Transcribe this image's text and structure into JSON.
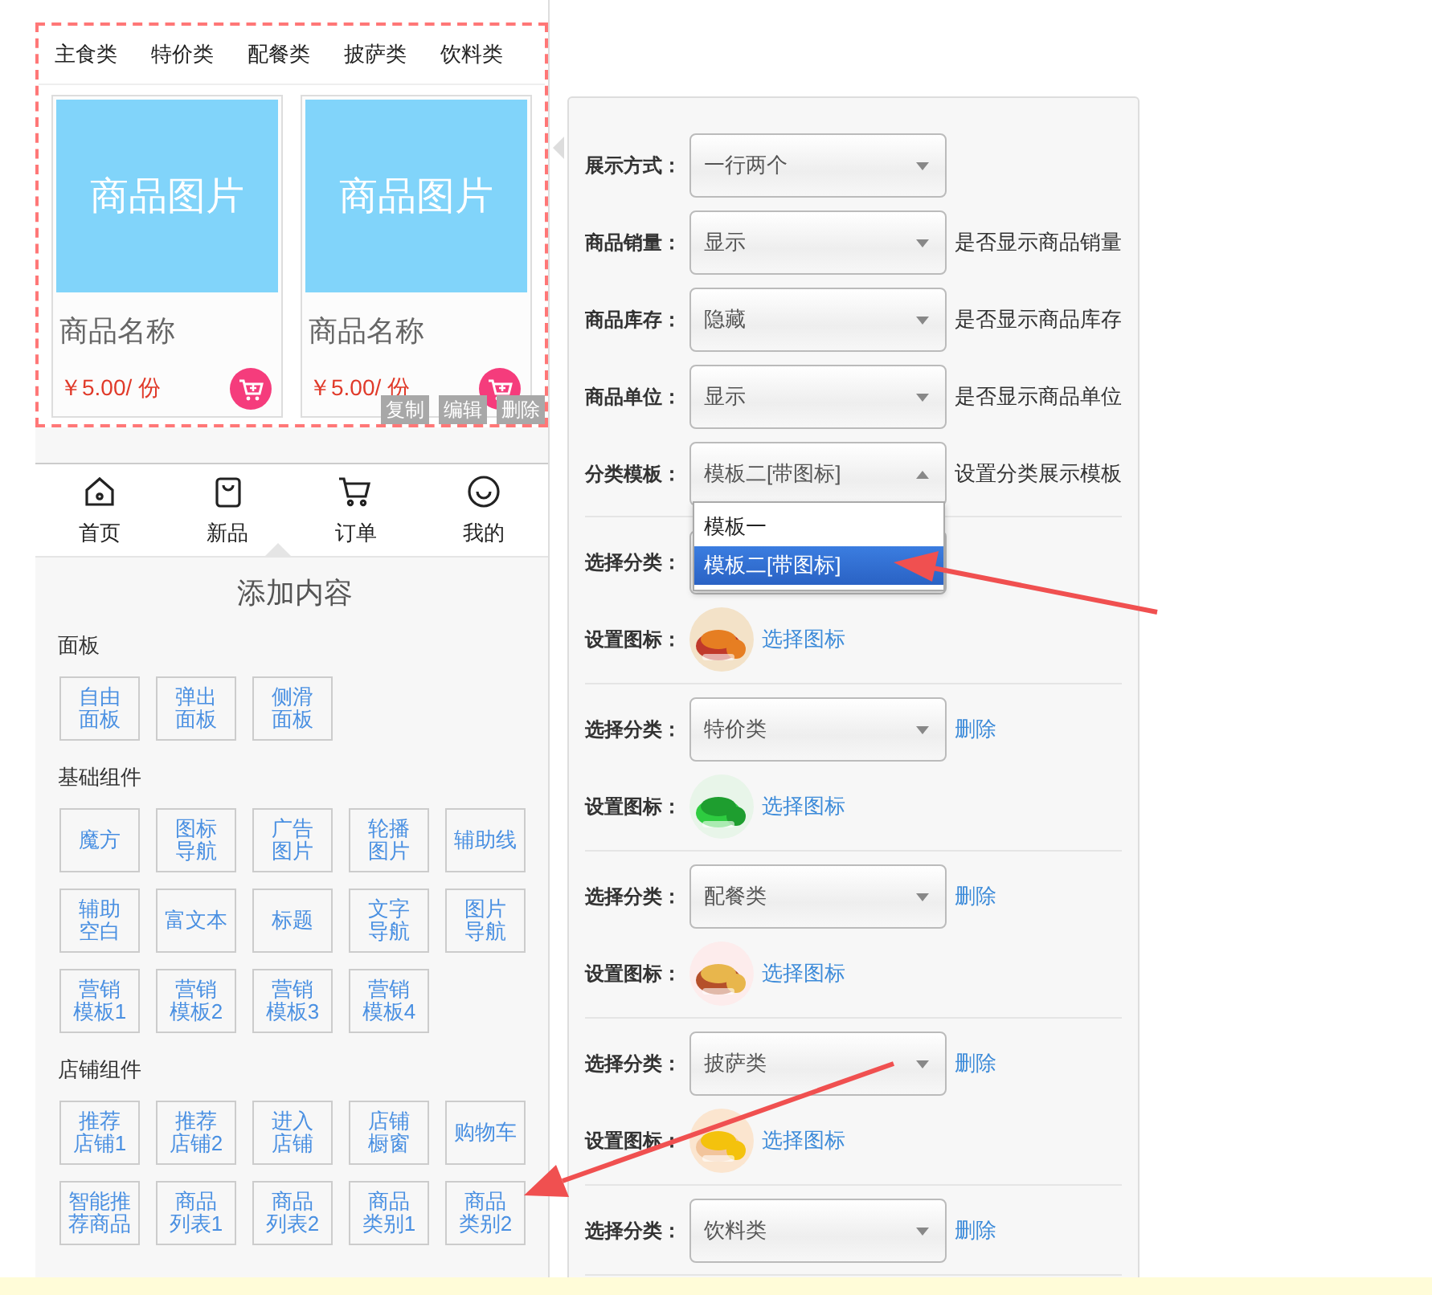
{
  "preview": {
    "category_tabs": [
      {
        "label": "主食类"
      },
      {
        "label": "特价类"
      },
      {
        "label": "配餐类"
      },
      {
        "label": "披萨类"
      },
      {
        "label": "饮料类"
      }
    ],
    "products": [
      {
        "image_text": "商品图片",
        "name": "商品名称",
        "price": "￥5.00/ 份"
      },
      {
        "image_text": "商品图片",
        "name": "商品名称",
        "price": "￥5.00/ 份"
      }
    ],
    "actions": [
      "复制",
      "编辑",
      "删除"
    ]
  },
  "bottom_nav": [
    {
      "label": "首页"
    },
    {
      "label": "新品"
    },
    {
      "label": "订单"
    },
    {
      "label": "我的"
    }
  ],
  "add_panel": {
    "title": "添加内容",
    "groups": [
      {
        "title": "面板",
        "items": [
          {
            "lines": [
              "自由",
              "面板"
            ]
          },
          {
            "lines": [
              "弹出",
              "面板"
            ]
          },
          {
            "lines": [
              "侧滑",
              "面板"
            ]
          }
        ]
      },
      {
        "title": "基础组件",
        "items": [
          {
            "lines": [
              "魔方"
            ]
          },
          {
            "lines": [
              "图标",
              "导航"
            ]
          },
          {
            "lines": [
              "广告",
              "图片"
            ]
          },
          {
            "lines": [
              "轮播",
              "图片"
            ]
          },
          {
            "lines": [
              "辅助线"
            ]
          },
          {
            "lines": [
              "辅助",
              "空白"
            ]
          },
          {
            "lines": [
              "富文本"
            ]
          },
          {
            "lines": [
              "标题"
            ]
          },
          {
            "lines": [
              "文字",
              "导航"
            ]
          },
          {
            "lines": [
              "图片",
              "导航"
            ]
          },
          {
            "lines": [
              "营销",
              "模板1"
            ]
          },
          {
            "lines": [
              "营销",
              "模板2"
            ]
          },
          {
            "lines": [
              "营销",
              "模板3"
            ]
          },
          {
            "lines": [
              "营销",
              "模板4"
            ]
          }
        ]
      },
      {
        "title": "店铺组件",
        "items": [
          {
            "lines": [
              "推荐",
              "店铺1"
            ]
          },
          {
            "lines": [
              "推荐",
              "店铺2"
            ]
          },
          {
            "lines": [
              "进入",
              "店铺"
            ]
          },
          {
            "lines": [
              "店铺",
              "橱窗"
            ]
          },
          {
            "lines": [
              "购物车"
            ]
          },
          {
            "lines": [
              "智能推",
              "荐商品"
            ]
          },
          {
            "lines": [
              "商品",
              "列表1"
            ]
          },
          {
            "lines": [
              "商品",
              "列表2"
            ]
          },
          {
            "lines": [
              "商品",
              "类别1"
            ]
          },
          {
            "lines": [
              "商品",
              "类别2"
            ]
          }
        ]
      }
    ]
  },
  "settings": [
    {
      "label": "展示方式：",
      "value": "一行两个",
      "open": false
    },
    {
      "label": "商品销量：",
      "value": "显示",
      "hint": "是否显示商品销量",
      "open": false
    },
    {
      "label": "商品库存：",
      "value": "隐藏",
      "hint": "是否显示商品库存",
      "open": false
    },
    {
      "label": "商品单位：",
      "value": "显示",
      "hint": "是否显示商品单位",
      "open": false
    },
    {
      "label": "分类模板：",
      "value": "模板二[带图标]",
      "hint": "设置分类展示模板",
      "open": true,
      "options": [
        {
          "label": "模板一",
          "selected": false
        },
        {
          "label": "模板二[带图标]",
          "selected": true
        }
      ]
    }
  ],
  "categories": [
    {
      "label": "选择分类：",
      "icon_label": "设置图标：",
      "icon_link": "选择图标"
    },
    {
      "label": "选择分类：",
      "value": "特价类",
      "delete": "删除",
      "icon_label": "设置图标：",
      "icon_link": "选择图标"
    },
    {
      "label": "选择分类：",
      "value": "配餐类",
      "delete": "删除",
      "icon_label": "设置图标：",
      "icon_link": "选择图标"
    },
    {
      "label": "选择分类：",
      "value": "披萨类",
      "delete": "删除",
      "icon_label": "设置图标：",
      "icon_link": "选择图标"
    },
    {
      "label": "选择分类：",
      "value": "饮料类",
      "delete": "删除"
    }
  ]
}
